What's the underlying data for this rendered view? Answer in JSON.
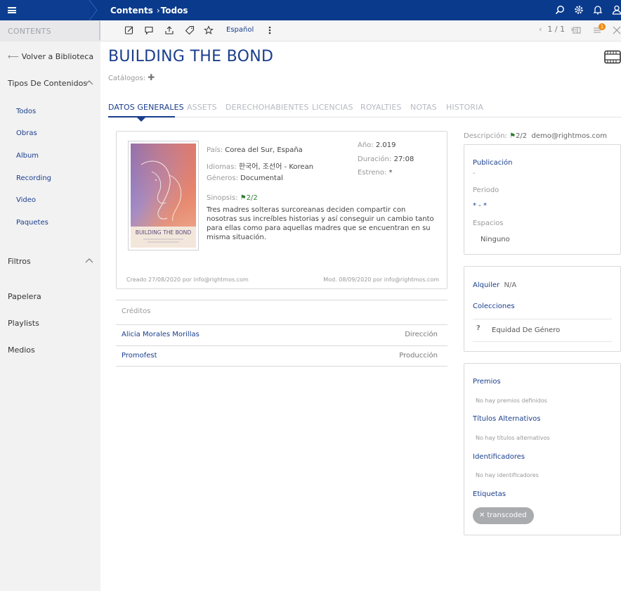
{
  "header": {
    "breadcrumb_section": "Contents",
    "breadcrumb_current": "Todos"
  },
  "sidebar": {
    "heading": "CONTENTS",
    "back_label": "Volver a Biblioteca",
    "content_types_label": "Tipos De Contenidos",
    "items": [
      {
        "label": "Todos"
      },
      {
        "label": "Obras"
      },
      {
        "label": "Album"
      },
      {
        "label": "Recording"
      },
      {
        "label": "Video"
      },
      {
        "label": "Paquetes"
      }
    ],
    "filters_label": "Filtros",
    "links": [
      {
        "label": "Papelera"
      },
      {
        "label": "Playlists"
      },
      {
        "label": "Medios"
      }
    ]
  },
  "toolbar": {
    "language": "Español",
    "pager": "1 / 1",
    "notification_count": "1"
  },
  "content": {
    "title": "BUILDING THE BOND",
    "catalogs_label": "Catálogos:",
    "tabs": [
      {
        "label": "DATOS GENERALES",
        "active": true
      },
      {
        "label": "ASSETS"
      },
      {
        "label": "DERECHOHABIENTES"
      },
      {
        "label": "LICENCIAS"
      },
      {
        "label": "ROYALTIES"
      },
      {
        "label": "NOTAS"
      },
      {
        "label": "HISTORIA"
      }
    ],
    "poster_title": "BUILDING THE BOND",
    "country_label": "País:",
    "country": "Corea del Sur, España",
    "languages_label": "Idiomas:",
    "languages": "한국어, 조선어 - Korean",
    "genres_label": "Géneros:",
    "genres": "Documental",
    "synopsis_label": "Sinopsis:",
    "synopsis_count": "2/2",
    "synopsis": "Tres madres solteras surcoreanas deciden compartir con nosotras sus increíbles historias y así conseguir un cambio tanto para ellas como para aquellas madres que se encuentran en su misma situación.",
    "year_label": "Año:",
    "year": "2.019",
    "duration_label": "Duración:",
    "duration": "27:08",
    "premiere_label": "Estreno:",
    "premiere": "*",
    "created": "Creado 27/08/2020 por info@rightmos.com",
    "modified": "Mod. 08/09/2020 por info@rightmos.com",
    "credits_heading": "Créditos",
    "credits": [
      {
        "name": "Alicia Morales Morillas",
        "role": "Dirección"
      },
      {
        "name": "Promofest",
        "role": "Producción"
      }
    ]
  },
  "aside": {
    "description_label": "Descripción:",
    "description_count": "2/2",
    "description_user": "demo@rightmos.com",
    "publication_label": "Publicación",
    "publication_value": "-",
    "period_label": "Periodo",
    "period_value": "* - *",
    "spaces_label": "Espacios",
    "spaces_value": "Ninguno",
    "rental_label": "Alquiler",
    "rental_value": "N/A",
    "collections_label": "Colecciones",
    "collection_item": "Equidad De Género",
    "awards_label": "Premios",
    "awards_empty": "No hay premios definidos",
    "alt_titles_label": "Títulos Alternativos",
    "alt_titles_empty": "No hay títulos alternativos",
    "identifiers_label": "Identificadores",
    "identifiers_empty": "No hay identificadores",
    "tags_label": "Etiquetas",
    "tag": "transcoded"
  },
  "colors": {
    "brand": "#0a3a8c",
    "accent_text": "#1a3e8c",
    "badge": "#f08a10",
    "flag": "#2e7d32"
  }
}
